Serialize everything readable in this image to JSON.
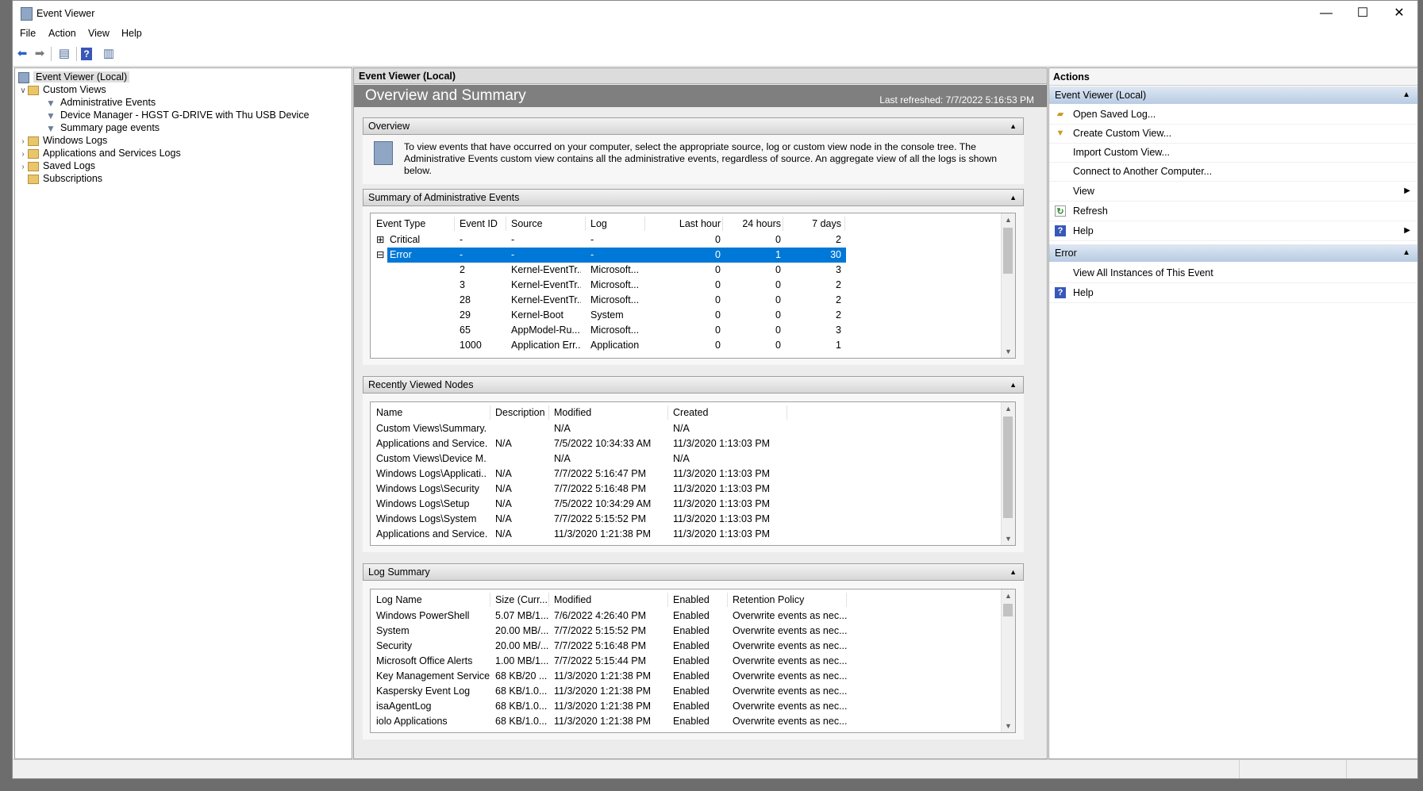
{
  "window": {
    "title": "Event Viewer",
    "minimize": "—",
    "maximize": "☐",
    "close": "✕"
  },
  "menu": [
    "File",
    "Action",
    "View",
    "Help"
  ],
  "tree": {
    "root": "Event Viewer (Local)",
    "custom_views": "Custom Views",
    "administrative_events": "Administrative Events",
    "device_manager": "Device Manager - HGST G-DRIVE with Thu USB Device",
    "summary_page_events": "Summary page events",
    "windows_logs": "Windows Logs",
    "apps_services_logs": "Applications and Services Logs",
    "saved_logs": "Saved Logs",
    "subscriptions": "Subscriptions"
  },
  "center": {
    "header": "Event Viewer (Local)",
    "banner_title": "Overview and Summary",
    "last_refreshed": "Last refreshed: 7/7/2022 5:16:53 PM",
    "overview": {
      "title": "Overview",
      "text": "To view events that have occurred on your computer, select the appropriate source, log or custom view node in the console tree. The Administrative Events custom view contains all the administrative events, regardless of source. An aggregate view of all the logs is shown below."
    },
    "admin_summary": {
      "title": "Summary of Administrative Events",
      "columns": [
        "Event Type",
        "Event ID",
        "Source",
        "Log",
        "Last hour",
        "24 hours",
        "7 days"
      ],
      "rows": [
        {
          "type": "Critical",
          "id": "-",
          "source": "-",
          "log": "-",
          "hour": "0",
          "day": "0",
          "week": "2"
        },
        {
          "type": "Error",
          "id": "-",
          "source": "-",
          "log": "-",
          "hour": "0",
          "day": "1",
          "week": "30"
        },
        {
          "type": "",
          "id": "2",
          "source": "Kernel-EventTr...",
          "log": "Microsoft...",
          "hour": "0",
          "day": "0",
          "week": "3"
        },
        {
          "type": "",
          "id": "3",
          "source": "Kernel-EventTr...",
          "log": "Microsoft...",
          "hour": "0",
          "day": "0",
          "week": "2"
        },
        {
          "type": "",
          "id": "28",
          "source": "Kernel-EventTr...",
          "log": "Microsoft...",
          "hour": "0",
          "day": "0",
          "week": "2"
        },
        {
          "type": "",
          "id": "29",
          "source": "Kernel-Boot",
          "log": "System",
          "hour": "0",
          "day": "0",
          "week": "2"
        },
        {
          "type": "",
          "id": "65",
          "source": "AppModel-Ru...",
          "log": "Microsoft...",
          "hour": "0",
          "day": "0",
          "week": "3"
        },
        {
          "type": "",
          "id": "1000",
          "source": "Application Err...",
          "log": "Application",
          "hour": "0",
          "day": "0",
          "week": "1"
        }
      ]
    },
    "recent_nodes": {
      "title": "Recently Viewed Nodes",
      "columns": [
        "Name",
        "Description",
        "Modified",
        "Created"
      ],
      "rows": [
        {
          "name": "Custom Views\\Summary...",
          "desc": "",
          "modified": "N/A",
          "created": "N/A"
        },
        {
          "name": "Applications and Service...",
          "desc": "N/A",
          "modified": "7/5/2022 10:34:33 AM",
          "created": "11/3/2020 1:13:03 PM"
        },
        {
          "name": "Custom Views\\Device M...",
          "desc": "",
          "modified": "N/A",
          "created": "N/A"
        },
        {
          "name": "Windows Logs\\Applicati...",
          "desc": "N/A",
          "modified": "7/7/2022 5:16:47 PM",
          "created": "11/3/2020 1:13:03 PM"
        },
        {
          "name": "Windows Logs\\Security",
          "desc": "N/A",
          "modified": "7/7/2022 5:16:48 PM",
          "created": "11/3/2020 1:13:03 PM"
        },
        {
          "name": "Windows Logs\\Setup",
          "desc": "N/A",
          "modified": "7/5/2022 10:34:29 AM",
          "created": "11/3/2020 1:13:03 PM"
        },
        {
          "name": "Windows Logs\\System",
          "desc": "N/A",
          "modified": "7/7/2022 5:15:52 PM",
          "created": "11/3/2020 1:13:03 PM"
        },
        {
          "name": "Applications and Service...",
          "desc": "N/A",
          "modified": "11/3/2020 1:21:38 PM",
          "created": "11/3/2020 1:13:03 PM"
        }
      ]
    },
    "log_summary": {
      "title": "Log Summary",
      "columns": [
        "Log Name",
        "Size (Curr...",
        "Modified",
        "Enabled",
        "Retention Policy"
      ],
      "rows": [
        {
          "name": "Windows PowerShell",
          "size": "5.07 MB/1...",
          "modified": "7/6/2022 4:26:40 PM",
          "enabled": "Enabled",
          "policy": "Overwrite events as nec..."
        },
        {
          "name": "System",
          "size": "20.00 MB/...",
          "modified": "7/7/2022 5:15:52 PM",
          "enabled": "Enabled",
          "policy": "Overwrite events as nec..."
        },
        {
          "name": "Security",
          "size": "20.00 MB/...",
          "modified": "7/7/2022 5:16:48 PM",
          "enabled": "Enabled",
          "policy": "Overwrite events as nec..."
        },
        {
          "name": "Microsoft Office Alerts",
          "size": "1.00 MB/1...",
          "modified": "7/7/2022 5:15:44 PM",
          "enabled": "Enabled",
          "policy": "Overwrite events as nec..."
        },
        {
          "name": "Key Management Service",
          "size": "68 KB/20 ...",
          "modified": "11/3/2020 1:21:38 PM",
          "enabled": "Enabled",
          "policy": "Overwrite events as nec..."
        },
        {
          "name": "Kaspersky Event Log",
          "size": "68 KB/1.0...",
          "modified": "11/3/2020 1:21:38 PM",
          "enabled": "Enabled",
          "policy": "Overwrite events as nec..."
        },
        {
          "name": "isaAgentLog",
          "size": "68 KB/1.0...",
          "modified": "11/3/2020 1:21:38 PM",
          "enabled": "Enabled",
          "policy": "Overwrite events as nec..."
        },
        {
          "name": "iolo Applications",
          "size": "68 KB/1.0...",
          "modified": "11/3/2020 1:21:38 PM",
          "enabled": "Enabled",
          "policy": "Overwrite events as nec..."
        }
      ]
    }
  },
  "actions": {
    "title": "Actions",
    "group1": "Event Viewer (Local)",
    "open_saved_log": "Open Saved Log...",
    "create_custom_view": "Create Custom View...",
    "import_custom_view": "Import Custom View...",
    "connect": "Connect to Another Computer...",
    "view": "View",
    "refresh": "Refresh",
    "help": "Help",
    "group2": "Error",
    "view_all_instances": "View All Instances of This Event",
    "help2": "Help"
  },
  "colors": {
    "selection": "#0078d7",
    "action_group": "#b7cbe3"
  }
}
